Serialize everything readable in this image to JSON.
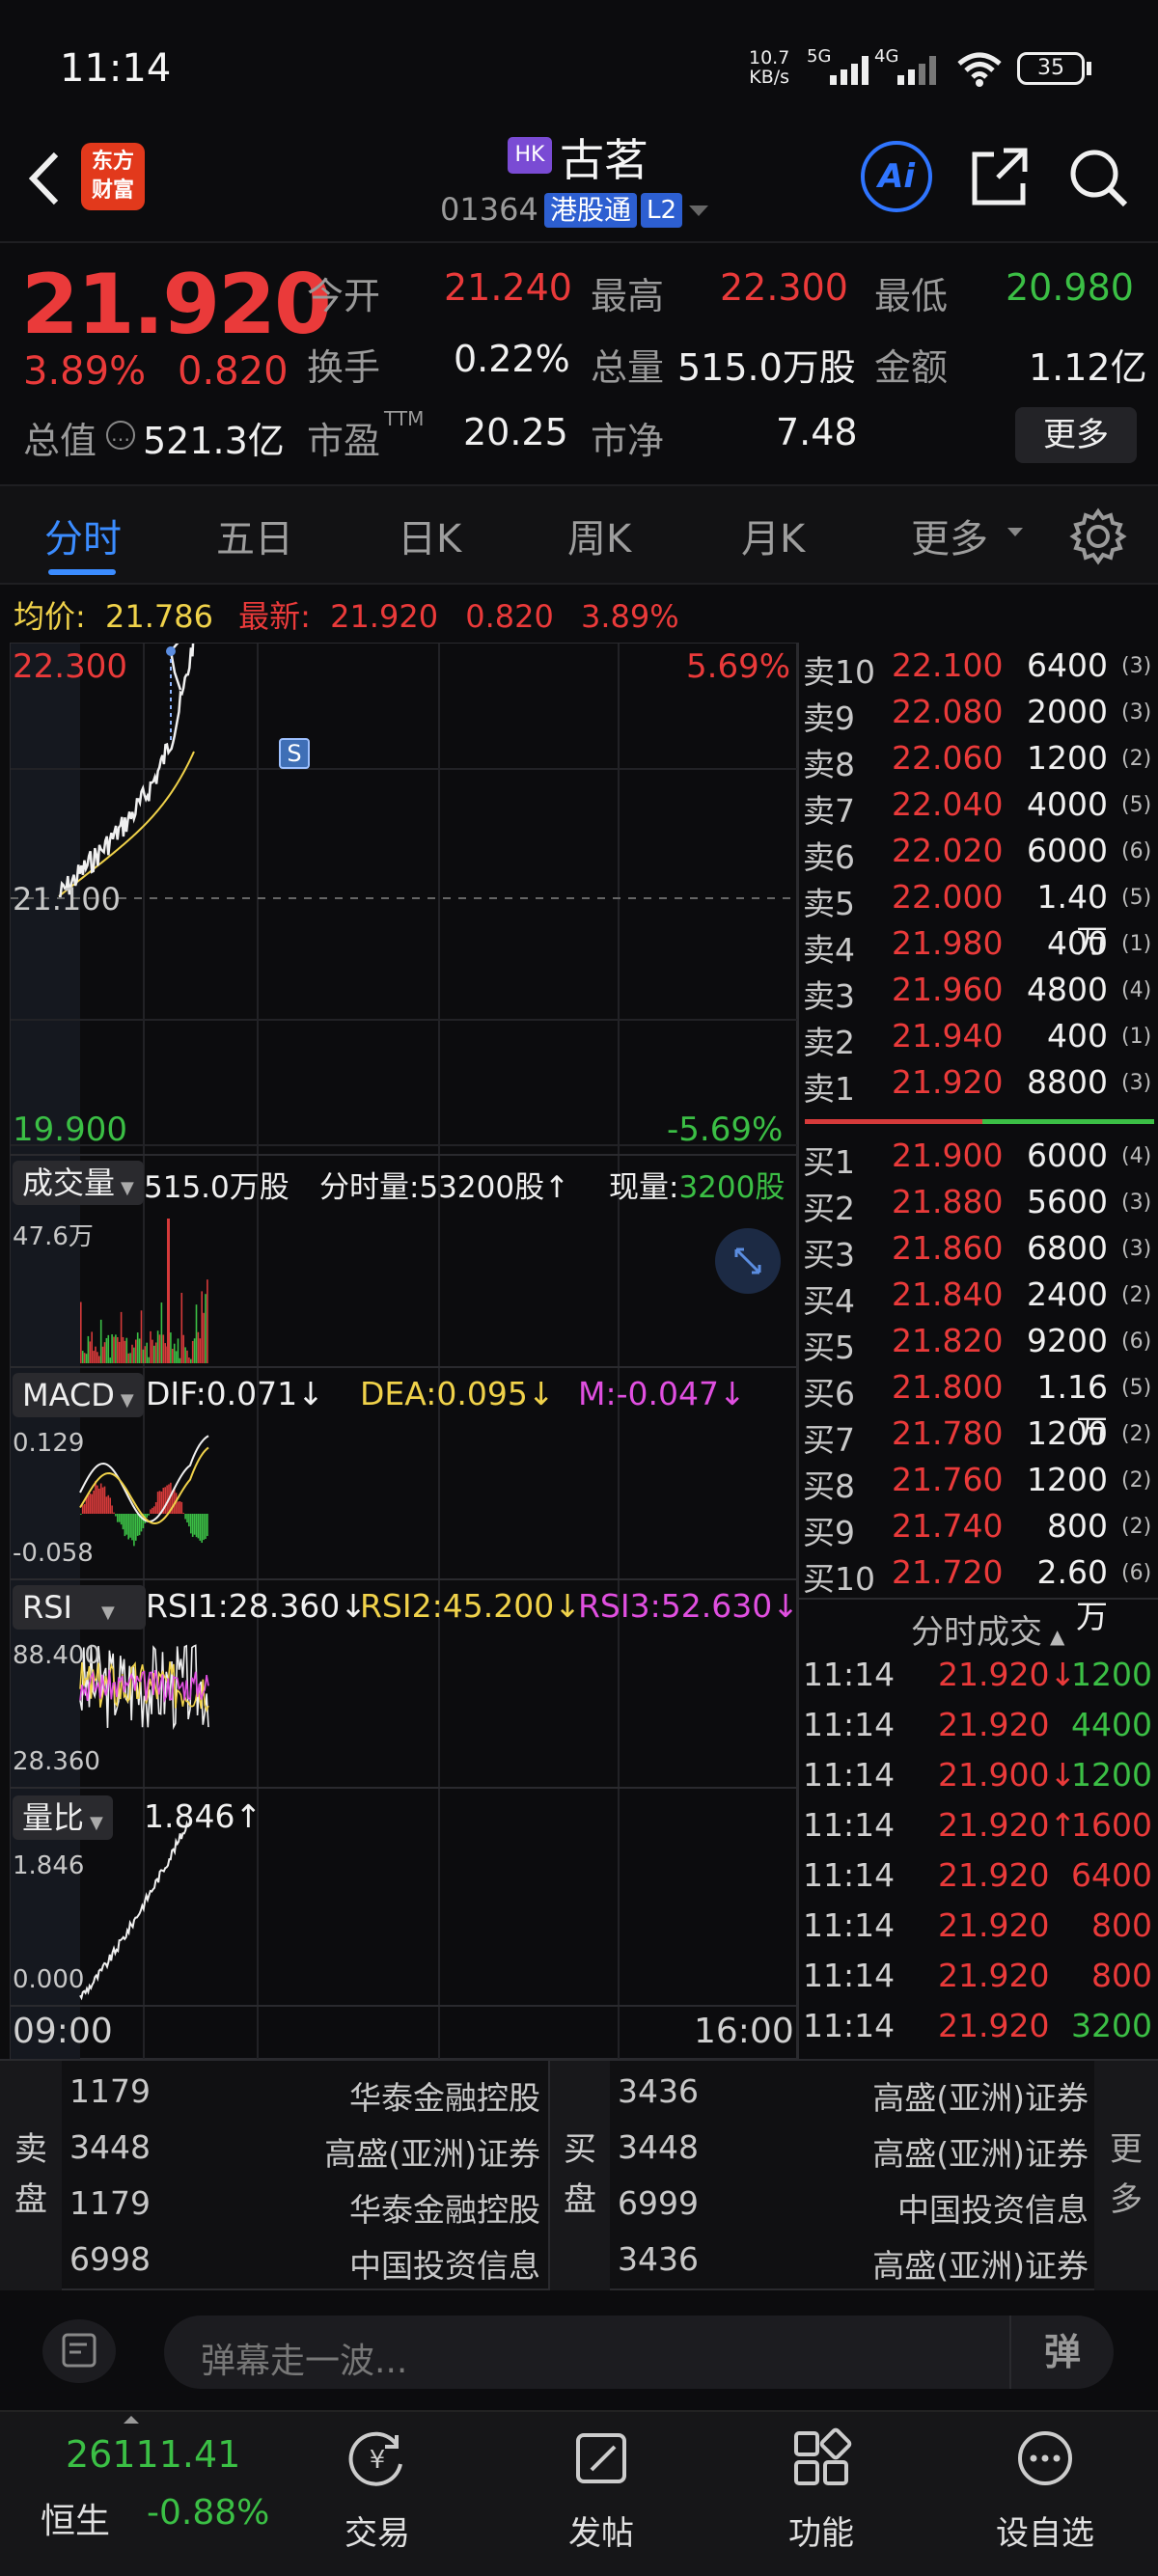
{
  "status_bar": {
    "time": "11:14",
    "net_speed_top": "10.7",
    "net_speed_unit": "KB/s",
    "signal_a": "5G",
    "signal_b": "4G",
    "battery": "35"
  },
  "header": {
    "logo_line1": "东方",
    "logo_line2": "财富",
    "market_badge": "HK",
    "title": "古茗",
    "code": "01364",
    "channel": "港股通",
    "level": "L2",
    "ai_label": "Ai"
  },
  "quote": {
    "price": "21.920",
    "pct": "3.89%",
    "change": "0.820",
    "open_label": "今开",
    "open": "21.240",
    "high_label": "最高",
    "high": "22.300",
    "low_label": "最低",
    "low": "20.980",
    "turnover_label": "换手",
    "turnover": "0.22%",
    "volume_label": "总量",
    "volume": "515.0万股",
    "amount_label": "金额",
    "amount": "1.12亿",
    "mcap_label": "总值",
    "mcap": "521.3亿",
    "pe_label": "市盈",
    "pe_sup": "TTM",
    "pe": "20.25",
    "pb_label": "市净",
    "pb": "7.48",
    "more": "更多"
  },
  "tabs": [
    {
      "label": "分时"
    },
    {
      "label": "五日"
    },
    {
      "label": "日K"
    },
    {
      "label": "周K"
    },
    {
      "label": "月K"
    },
    {
      "label": "更多"
    }
  ],
  "avg_line": {
    "avg_label": "均价:",
    "avg": "21.786",
    "last_label": "最新:",
    "last": "21.920",
    "chg": "0.820",
    "pct": "3.89%"
  },
  "chart_main": {
    "ymax": "22.300",
    "ymid": "21.100",
    "ymin": "19.900",
    "pmax": "5.69%",
    "pmin": "-5.69%",
    "marker": "S"
  },
  "volume_panel": {
    "label": "成交量",
    "total": "515.0万股",
    "fs_label": "分时量:",
    "fs": "53200股↑",
    "now_label": "现量:",
    "now": "3200股",
    "ymax": "47.6万"
  },
  "macd_panel": {
    "label": "MACD",
    "dif": "DIF:0.071↓",
    "dea": "DEA:0.095↓",
    "m": "M:-0.047↓",
    "ymax": "0.129",
    "ymin": "-0.058"
  },
  "rsi_panel": {
    "label": "RSI",
    "rsi1": "RSI1:28.360↓",
    "rsi2": "RSI2:45.200↓",
    "rsi3": "RSI3:52.630↓",
    "ymax": "88.400",
    "ymin": "28.360"
  },
  "ratio_panel": {
    "label": "量比",
    "value": "1.846↑",
    "ymax": "1.846",
    "ymin": "0.000"
  },
  "time_axis": {
    "start": "09:00",
    "end": "16:00"
  },
  "order_book": {
    "asks": [
      {
        "label": "卖10",
        "price": "22.100",
        "vol": "6400",
        "n": "(3)"
      },
      {
        "label": "卖9",
        "price": "22.080",
        "vol": "2000",
        "n": "(3)"
      },
      {
        "label": "卖8",
        "price": "22.060",
        "vol": "1200",
        "n": "(2)"
      },
      {
        "label": "卖7",
        "price": "22.040",
        "vol": "4000",
        "n": "(5)"
      },
      {
        "label": "卖6",
        "price": "22.020",
        "vol": "6000",
        "n": "(6)"
      },
      {
        "label": "卖5",
        "price": "22.000",
        "vol": "1.40万",
        "n": "(5)"
      },
      {
        "label": "卖4",
        "price": "21.980",
        "vol": "400",
        "n": "(1)"
      },
      {
        "label": "卖3",
        "price": "21.960",
        "vol": "4800",
        "n": "(4)"
      },
      {
        "label": "卖2",
        "price": "21.940",
        "vol": "400",
        "n": "(1)"
      },
      {
        "label": "卖1",
        "price": "21.920",
        "vol": "8800",
        "n": "(3)"
      }
    ],
    "bids": [
      {
        "label": "买1",
        "price": "21.900",
        "vol": "6000",
        "n": "(4)"
      },
      {
        "label": "买2",
        "price": "21.880",
        "vol": "5600",
        "n": "(3)"
      },
      {
        "label": "买3",
        "price": "21.860",
        "vol": "6800",
        "n": "(3)"
      },
      {
        "label": "买4",
        "price": "21.840",
        "vol": "2400",
        "n": "(2)"
      },
      {
        "label": "买5",
        "price": "21.820",
        "vol": "9200",
        "n": "(6)"
      },
      {
        "label": "买6",
        "price": "21.800",
        "vol": "1.16万",
        "n": "(5)"
      },
      {
        "label": "买7",
        "price": "21.780",
        "vol": "1200",
        "n": "(2)"
      },
      {
        "label": "买8",
        "price": "21.760",
        "vol": "1200",
        "n": "(2)"
      },
      {
        "label": "买9",
        "price": "21.740",
        "vol": "800",
        "n": "(2)"
      },
      {
        "label": "买10",
        "price": "21.720",
        "vol": "2.60万",
        "n": "(6)"
      }
    ]
  },
  "ticks": {
    "title": "分时成交",
    "rows": [
      {
        "time": "11:14",
        "price": "21.920↓",
        "vol": "1200",
        "color": "#3bbf45"
      },
      {
        "time": "11:14",
        "price": "21.920",
        "vol": "4400",
        "color": "#3bbf45"
      },
      {
        "time": "11:14",
        "price": "21.900↓",
        "vol": "1200",
        "color": "#3bbf45"
      },
      {
        "time": "11:14",
        "price": "21.920↑",
        "vol": "1600",
        "color": "#ea3a3a"
      },
      {
        "time": "11:14",
        "price": "21.920",
        "vol": "6400",
        "color": "#ea3a3a"
      },
      {
        "time": "11:14",
        "price": "21.920",
        "vol": "800",
        "color": "#ea3a3a"
      },
      {
        "time": "11:14",
        "price": "21.920",
        "vol": "800",
        "color": "#ea3a3a"
      },
      {
        "time": "11:14",
        "price": "21.920",
        "vol": "3200",
        "color": "#3bbf45"
      }
    ]
  },
  "brokers": {
    "sell_label_1": "卖",
    "sell_label_2": "盘",
    "buy_label_1": "买",
    "buy_label_2": "盘",
    "more_1": "更",
    "more_2": "多",
    "sell": [
      {
        "id": "1179",
        "name": "华泰金融控股"
      },
      {
        "id": "3448",
        "name": "高盛(亚洲)证券"
      },
      {
        "id": "1179",
        "name": "华泰金融控股"
      },
      {
        "id": "6998",
        "name": "中国投资信息"
      }
    ],
    "buy": [
      {
        "id": "3436",
        "name": "高盛(亚洲)证券"
      },
      {
        "id": "3448",
        "name": "高盛(亚洲)证券"
      },
      {
        "id": "6999",
        "name": "中国投资信息"
      },
      {
        "id": "3436",
        "name": "高盛(亚洲)证券"
      }
    ]
  },
  "danmu": {
    "placeholder": "弹幕走一波...",
    "btn": "弹"
  },
  "bottom_nav": {
    "index_value": "26111.41",
    "index_name": "恒生",
    "index_pct": "-0.88%",
    "trade": "交易",
    "post": "发帖",
    "func": "功能",
    "watch": "设自选"
  }
}
